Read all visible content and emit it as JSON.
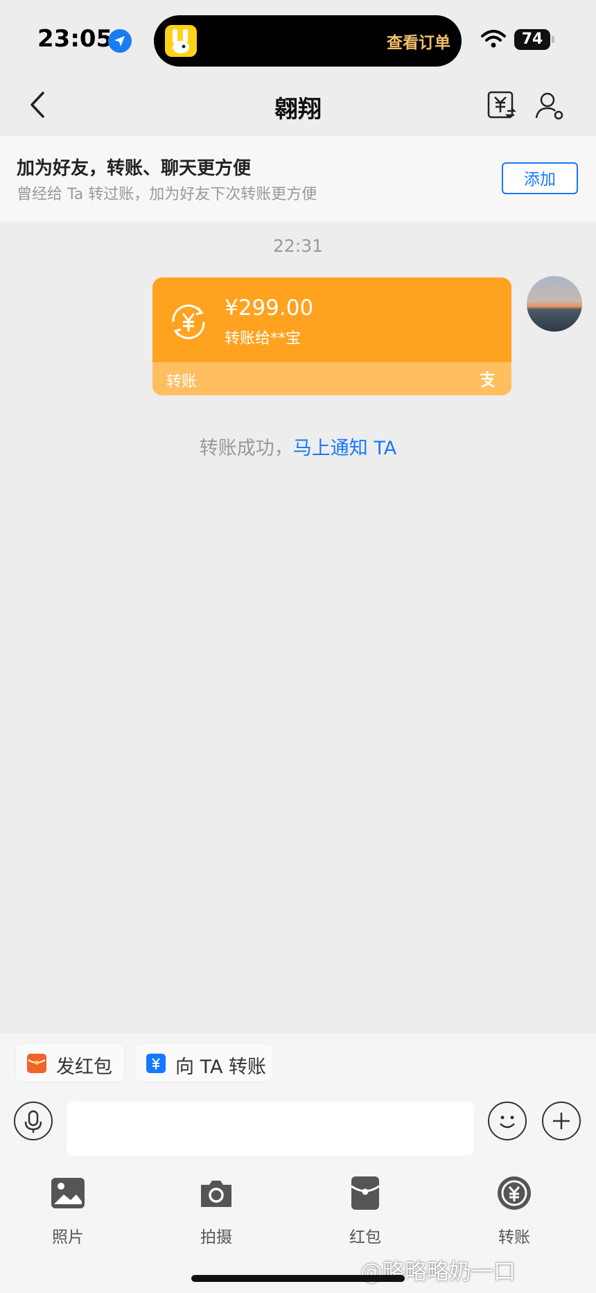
{
  "status_bar": {
    "time": "23:05",
    "island_text": "查看订单",
    "battery": "74"
  },
  "nav": {
    "title": "翱翔"
  },
  "banner": {
    "title": "加为好友，转账、聊天更方便",
    "subtitle": "曾经给 Ta 转过账，加为好友下次转账更方便",
    "add_label": "添加"
  },
  "chat": {
    "timestamp": "22:31",
    "card": {
      "amount": "¥299.00",
      "subtitle": "转账给**宝",
      "type": "转账"
    },
    "notice_text": "转账成功，",
    "notice_link": "马上通知 TA"
  },
  "quick_chips": [
    {
      "label": "发红包"
    },
    {
      "label": "向 TA 转账"
    }
  ],
  "tools": [
    {
      "label": "照片",
      "icon": "photo-icon"
    },
    {
      "label": "拍摄",
      "icon": "camera-icon"
    },
    {
      "label": "红包",
      "icon": "red-packet-icon"
    },
    {
      "label": "转账",
      "icon": "transfer-icon"
    }
  ],
  "watermark": "@略略略奶一口",
  "colors": {
    "accent_blue": "#1677ff",
    "card_orange": "#ffa220",
    "card_orange_light": "#ffbe60",
    "red_packet": "#f2622a"
  }
}
